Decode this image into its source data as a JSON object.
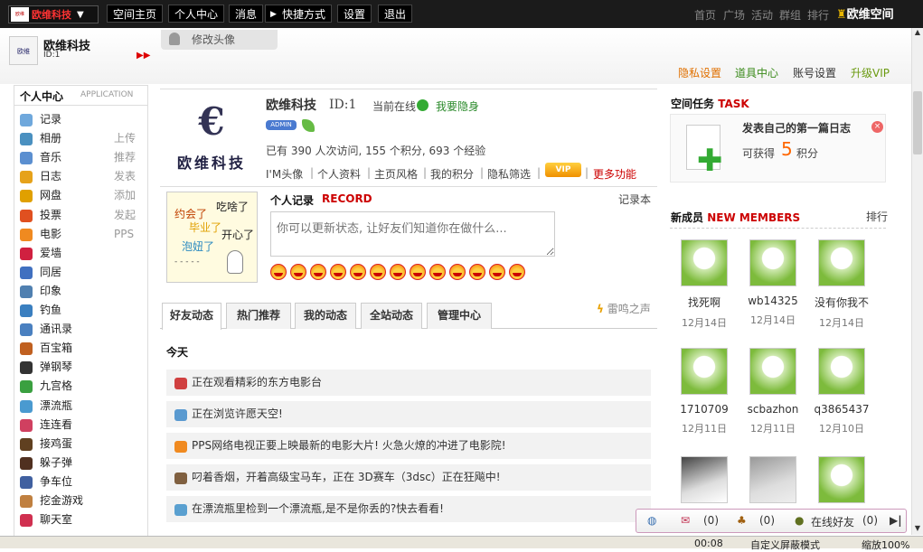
{
  "topbar": {
    "brand": "欧维科技",
    "nav": [
      "空间主页",
      "个人中心",
      "消息",
      "快捷方式",
      "设置",
      "退出"
    ],
    "right_nav": [
      "首页",
      "广场",
      "活动",
      "群组",
      "排行"
    ],
    "logo_text": "欧维空间"
  },
  "profile_header": {
    "name": "欧维科技",
    "id": "ID:1",
    "edit_avatar": "修改头像",
    "links": [
      "隐私设置",
      "道具中心",
      "账号设置",
      "升级VIP"
    ]
  },
  "sidebar": {
    "title": "个人中心",
    "subtitle": "APPLICATION",
    "items": [
      {
        "label": "记录",
        "extra": "",
        "icon": "record-icon",
        "color": "#6fa8dc"
      },
      {
        "label": "相册",
        "extra": "上传",
        "icon": "album-icon",
        "color": "#4a90c0"
      },
      {
        "label": "音乐",
        "extra": "推荐",
        "icon": "music-icon",
        "color": "#5b8fd0"
      },
      {
        "label": "日志",
        "extra": "发表",
        "icon": "blog-icon",
        "color": "#e6a21a"
      },
      {
        "label": "网盘",
        "extra": "添加",
        "icon": "disk-icon",
        "color": "#e0a000"
      },
      {
        "label": "投票",
        "extra": "发起",
        "icon": "vote-icon",
        "color": "#e05020"
      },
      {
        "label": "电影",
        "extra": "PPS",
        "icon": "movie-icon",
        "color": "#f08a20"
      },
      {
        "label": "爱墙",
        "extra": "",
        "icon": "love-wall-icon",
        "color": "#d02040"
      },
      {
        "label": "同居",
        "extra": "",
        "icon": "cohabit-icon",
        "color": "#4070c0"
      },
      {
        "label": "印象",
        "extra": "",
        "icon": "impression-icon",
        "color": "#5080b0"
      },
      {
        "label": "钓鱼",
        "extra": "",
        "icon": "fishing-icon",
        "color": "#3a7fc0"
      },
      {
        "label": "通讯录",
        "extra": "",
        "icon": "contacts-icon",
        "color": "#4a80c0"
      },
      {
        "label": "百宝箱",
        "extra": "",
        "icon": "treasure-icon",
        "color": "#c06020"
      },
      {
        "label": "弹钢琴",
        "extra": "",
        "icon": "piano-icon",
        "color": "#333333"
      },
      {
        "label": "九宫格",
        "extra": "",
        "icon": "grid-icon",
        "color": "#3aa040"
      },
      {
        "label": "漂流瓶",
        "extra": "",
        "icon": "bottle-icon",
        "color": "#4a9ad0"
      },
      {
        "label": "连连看",
        "extra": "",
        "icon": "match-icon",
        "color": "#d04060"
      },
      {
        "label": "接鸡蛋",
        "extra": "",
        "icon": "egg-icon",
        "color": "#604020"
      },
      {
        "label": "躲子弹",
        "extra": "",
        "icon": "dodge-icon",
        "color": "#503020"
      },
      {
        "label": "争车位",
        "extra": "",
        "icon": "parking-icon",
        "color": "#4060a0"
      },
      {
        "label": "挖金游戏",
        "extra": "",
        "icon": "gold-icon",
        "color": "#c08040"
      },
      {
        "label": "聊天室",
        "extra": "",
        "icon": "chat-icon",
        "color": "#d03050"
      }
    ]
  },
  "profile": {
    "avatar_text": "欧维科技",
    "name": "欧维科技",
    "id": "ID:1",
    "status": "当前在线",
    "hide": "我要隐身",
    "badge": "ADMIN",
    "stats": "已有 390 人次访问, 155 个积分, 693 个经验",
    "links": [
      "I'M头像",
      "个人资料",
      "主页风格",
      "我的积分",
      "隐私筛选"
    ],
    "vip": "VIP",
    "more": "更多功能"
  },
  "record": {
    "title": "个人记录",
    "title_en": "RECORD",
    "book": "记录本",
    "placeholder": "你可以更新状态, 让好友们知道你在做什么...",
    "moods": [
      "约会了",
      "吃啥了",
      "毕业了",
      "开心了",
      "泡妞了"
    ],
    "dots": "- - - - -"
  },
  "tabs": [
    "好友动态",
    "热门推荐",
    "我的动态",
    "全站动态",
    "管理中心"
  ],
  "thunder": "雷鸣之声",
  "feed": {
    "today": "今天",
    "items": [
      {
        "text": "正在观看精彩的东方电影台",
        "color": "#d04040"
      },
      {
        "text": "正在浏览许愿天空!",
        "color": "#5a9ad0"
      },
      {
        "text": "PPS网络电视正要上映最新的电影大片! 火急火燎的冲进了电影院!",
        "color": "#f08a20"
      },
      {
        "text": "叼着香烟，开着高级宝马车，正在 3D赛车（3dsc）正在狂飚中!",
        "color": "#806040"
      },
      {
        "text": "在漂流瓶里检到一个漂流瓶,是不是你丢的?快去看看!",
        "color": "#5aa0d0"
      }
    ]
  },
  "task": {
    "title": "空间任务",
    "title_en": "TASK",
    "name": "发表自己的第一篇日志",
    "earn": "可获得",
    "points": "5",
    "unit": "积分"
  },
  "new_members": {
    "title": "新成员",
    "title_en": "NEW MEMBERS",
    "rank": "排行",
    "members": [
      {
        "name": "找死啊",
        "date": "12月14日"
      },
      {
        "name": "wb14325",
        "date": "12月14日"
      },
      {
        "name": "没有你我不",
        "date": "12月14日"
      },
      {
        "name": "1710709",
        "date": "12月11日"
      },
      {
        "name": "scbazhon",
        "date": "12月11日"
      },
      {
        "name": "q3865437",
        "date": "12月10日"
      },
      {
        "name": "",
        "date": ""
      },
      {
        "name": "",
        "date": ""
      },
      {
        "name": "",
        "date": ""
      }
    ]
  },
  "bottombar": {
    "msg_count": "(0)",
    "friend_req": "(0)",
    "online_label": "在线好友",
    "online_count": "(0)"
  },
  "statusbar": {
    "time": "00:08",
    "mode": "自定义屏蔽模式",
    "zoom": "缩放100%"
  }
}
